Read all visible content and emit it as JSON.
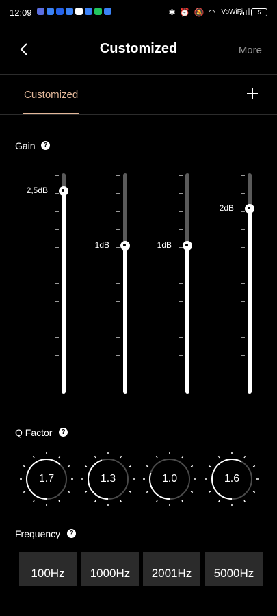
{
  "status_bar": {
    "time": "12:09",
    "app_icon_colors": [
      "#5b6ee1",
      "#3b82f6",
      "#2563eb",
      "#3b82f6",
      "#ffffff",
      "#3b82f6",
      "#22c55e",
      "#3b82f6"
    ],
    "network": "VoWiFi",
    "battery": "5"
  },
  "header": {
    "title": "Customized",
    "more_label": "More"
  },
  "tab": {
    "label": "Customized"
  },
  "gain": {
    "label": "Gain",
    "bands": [
      {
        "value_label": "2,5dB",
        "level": 0.92
      },
      {
        "value_label": "1dB",
        "level": 0.67
      },
      {
        "value_label": "1dB",
        "level": 0.67
      },
      {
        "value_label": "2dB",
        "level": 0.84
      }
    ]
  },
  "q_factor": {
    "label": "Q Factor",
    "knobs": [
      {
        "value": "1.7",
        "level": 0.62
      },
      {
        "value": "1.3",
        "level": 0.45
      },
      {
        "value": "1.0",
        "level": 0.3
      },
      {
        "value": "1.6",
        "level": 0.58
      }
    ]
  },
  "frequency": {
    "label": "Frequency",
    "buttons": [
      "100Hz",
      "1000Hz",
      "2001Hz",
      "5000Hz"
    ]
  },
  "colors": {
    "accent": "#e3b89a",
    "track_inactive": "#5a5a5a",
    "track_active": "#ffffff"
  }
}
